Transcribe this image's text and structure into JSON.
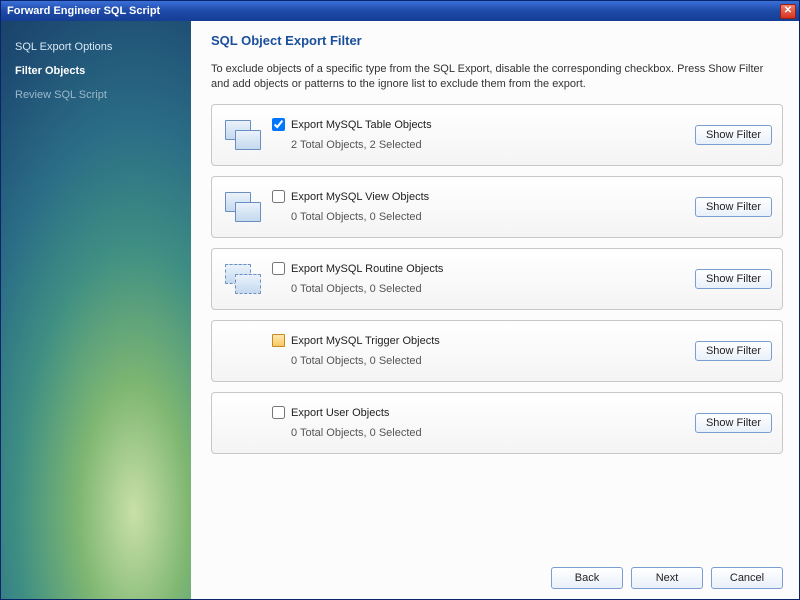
{
  "window": {
    "title": "Forward Engineer SQL Script"
  },
  "sidebar": {
    "steps": [
      {
        "label": "SQL Export Options",
        "state": "done"
      },
      {
        "label": "Filter Objects",
        "state": "active"
      },
      {
        "label": "Review SQL Script",
        "state": "pending"
      }
    ]
  },
  "page": {
    "title": "SQL Object Export Filter",
    "instructions": "To exclude objects of a specific type from the SQL Export, disable the corresponding checkbox. Press Show Filter and add objects or patterns to the ignore list to exclude them from the export."
  },
  "filter_button_label": "Show Filter",
  "items": [
    {
      "id": "table",
      "label": "Export MySQL Table Objects",
      "status": "2 Total Objects, 2 Selected",
      "checked": true,
      "icon": "table"
    },
    {
      "id": "view",
      "label": "Export MySQL View Objects",
      "status": "0 Total Objects, 0 Selected",
      "checked": false,
      "icon": "view"
    },
    {
      "id": "routine",
      "label": "Export MySQL Routine Objects",
      "status": "0 Total Objects, 0 Selected",
      "checked": false,
      "icon": "routine"
    },
    {
      "id": "trigger",
      "label": "Export MySQL Trigger Objects",
      "status": "0 Total Objects, 0 Selected",
      "checked": false,
      "icon": "none",
      "partial": true
    },
    {
      "id": "user",
      "label": "Export User Objects",
      "status": "0 Total Objects, 0 Selected",
      "checked": false,
      "icon": "none"
    }
  ],
  "footer": {
    "back": "Back",
    "next": "Next",
    "cancel": "Cancel"
  }
}
